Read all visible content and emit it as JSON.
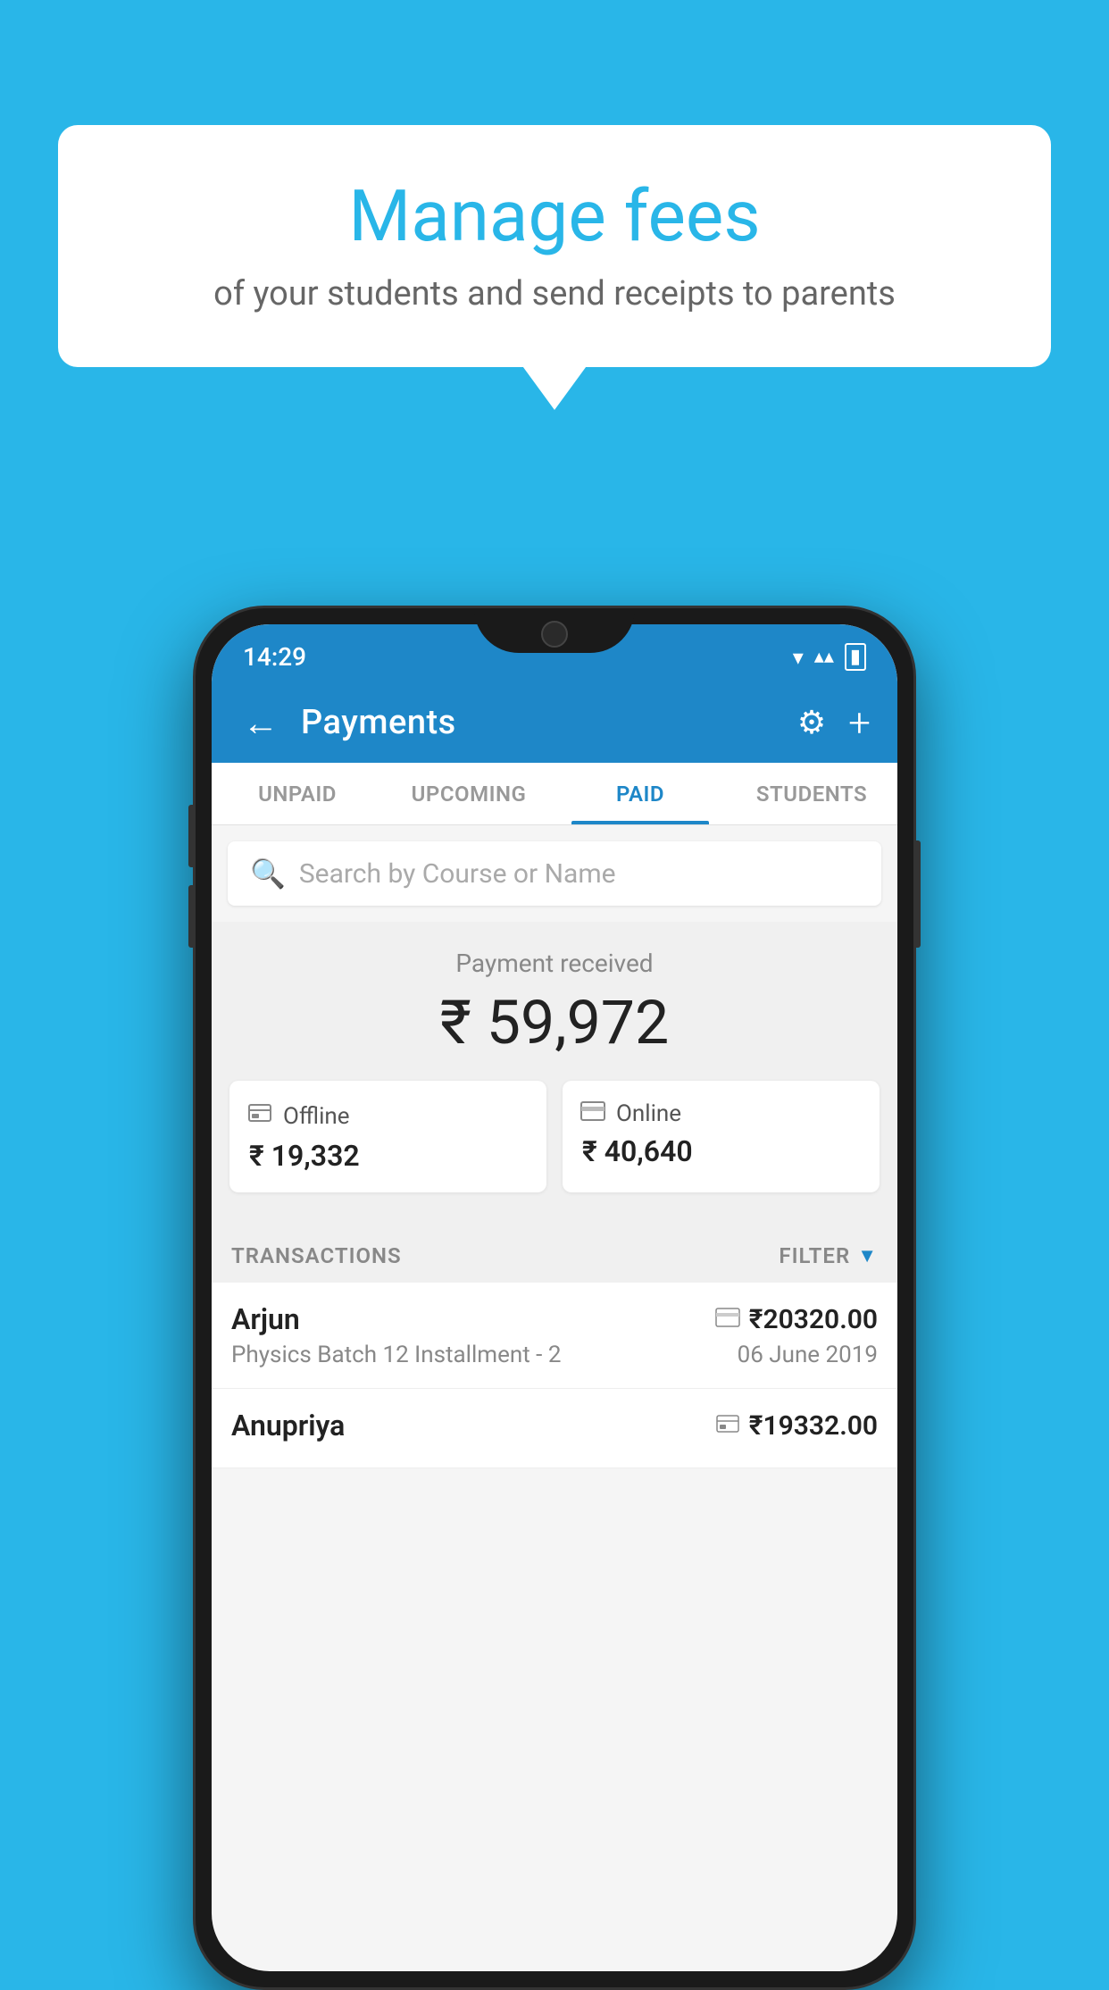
{
  "background_color": "#29b6e8",
  "speech_bubble": {
    "title": "Manage fees",
    "subtitle": "of your students and send receipts to parents"
  },
  "status_bar": {
    "time": "14:29",
    "wifi": "▼",
    "signal": "▲",
    "battery": "▮"
  },
  "top_bar": {
    "title": "Payments",
    "back_icon": "←",
    "settings_icon": "⚙",
    "add_icon": "+"
  },
  "tabs": [
    {
      "label": "UNPAID",
      "active": false
    },
    {
      "label": "UPCOMING",
      "active": false
    },
    {
      "label": "PAID",
      "active": true
    },
    {
      "label": "STUDENTS",
      "active": false
    }
  ],
  "search": {
    "placeholder": "Search by Course or Name"
  },
  "payment_summary": {
    "label": "Payment received",
    "total": "₹ 59,972",
    "offline": {
      "label": "Offline",
      "amount": "₹ 19,332"
    },
    "online": {
      "label": "Online",
      "amount": "₹ 40,640"
    }
  },
  "transactions": {
    "header_label": "TRANSACTIONS",
    "filter_label": "FILTER",
    "items": [
      {
        "name": "Arjun",
        "description": "Physics Batch 12 Installment - 2",
        "amount": "₹20320.00",
        "date": "06 June 2019",
        "payment_type": "online"
      },
      {
        "name": "Anupriya",
        "description": "",
        "amount": "₹19332.00",
        "date": "",
        "payment_type": "offline"
      }
    ]
  }
}
